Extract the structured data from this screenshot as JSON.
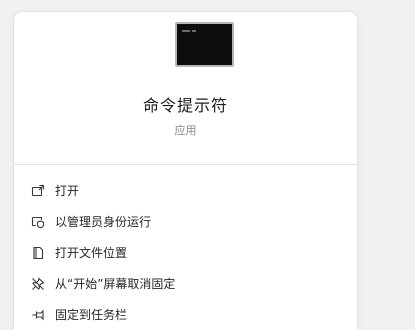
{
  "app": {
    "title": "命令提示符",
    "subtitle": "应用",
    "icon": "terminal-icon"
  },
  "menu": {
    "items": [
      {
        "label": "打开",
        "icon": "open-icon"
      },
      {
        "label": "以管理员身份运行",
        "icon": "shield-run-icon"
      },
      {
        "label": "打开文件位置",
        "icon": "file-location-icon"
      },
      {
        "label": "从“开始”屏幕取消固定",
        "icon": "unpin-icon"
      },
      {
        "label": "固定到任务栏",
        "icon": "pin-taskbar-icon"
      }
    ]
  },
  "colors": {
    "panel": "#ffffff",
    "background": "#f1f1f1",
    "text": "#262626",
    "subtext": "#8b8b8b"
  }
}
